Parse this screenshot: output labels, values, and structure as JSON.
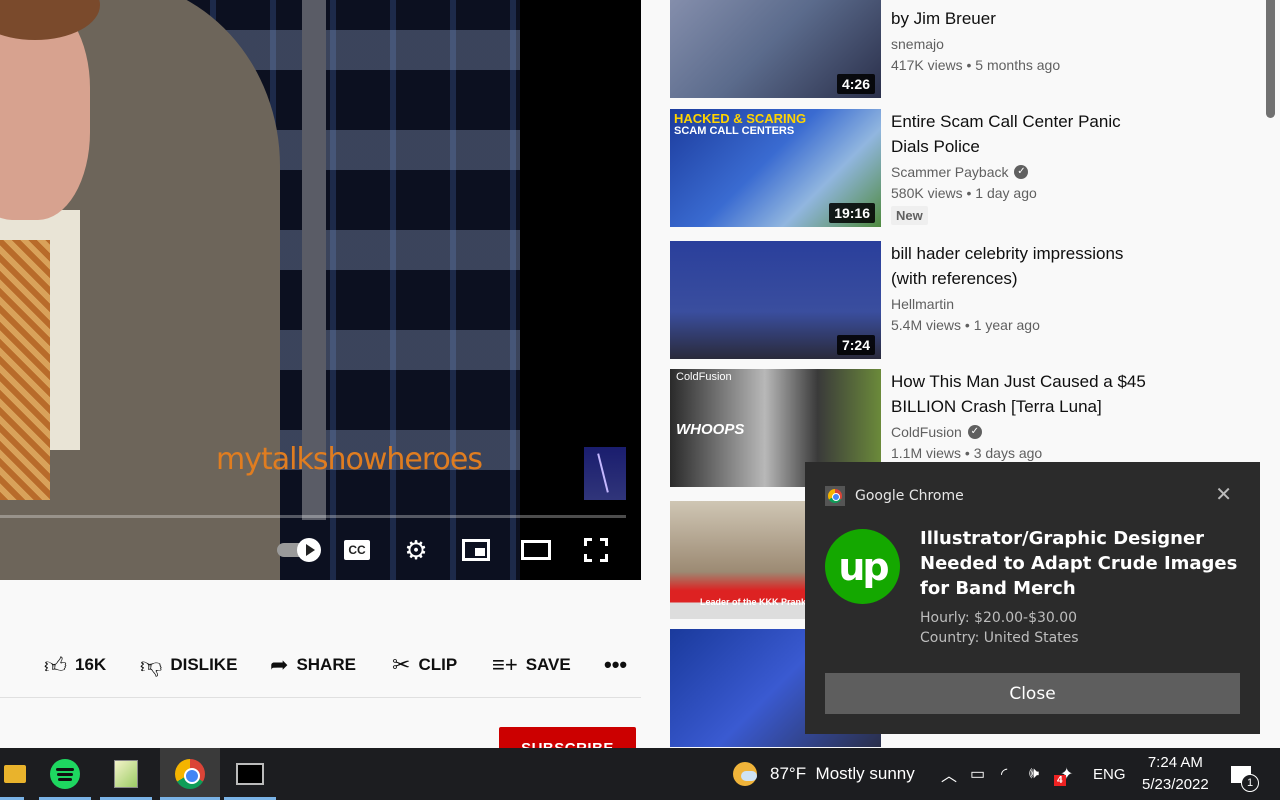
{
  "player": {
    "watermark": "mytalkshowheroes",
    "progress_fraction": 0.0,
    "controls": {
      "autoplay": "autoplay-toggle",
      "cc_label": "CC",
      "settings": "gear-icon",
      "miniplayer": "miniplayer-icon",
      "theater": "theater-icon",
      "fullscreen": "fullscreen-icon"
    }
  },
  "actions": {
    "like_count": "16K",
    "dislike_label": "DISLIKE",
    "share_label": "SHARE",
    "clip_label": "CLIP",
    "save_label": "SAVE",
    "more_label": "•••"
  },
  "subscribe_label": "SUBSCRIBE",
  "recommendations": [
    {
      "title": "by Jim Breuer",
      "channel": "snemajo",
      "verified": false,
      "views": "417K views",
      "age": "5 months ago",
      "duration": "4:26",
      "badge": ""
    },
    {
      "title": "Entire Scam Call Center Panic Dials Police",
      "channel": "Scammer Payback",
      "verified": true,
      "views": "580K views",
      "age": "1 day ago",
      "duration": "19:16",
      "badge": "New",
      "thumb_text_1": "HACKED & SCARING",
      "thumb_text_2": "SCAM CALL CENTERS"
    },
    {
      "title": "bill hader celebrity impressions (with references)",
      "channel": "Hellmartin",
      "verified": false,
      "views": "5.4M views",
      "age": "1 year ago",
      "duration": "7:24",
      "badge": ""
    },
    {
      "title": "How This Man Just Caused a $45 BILLION Crash [Terra Luna]",
      "channel": "ColdFusion",
      "verified": true,
      "views": "1.1M views",
      "age": "3 days ago",
      "duration": "",
      "badge": "",
      "thumb_text_1": "ColdFusion",
      "thumb_text_2": "WHOOPS"
    },
    {
      "title": "",
      "thumb_text_1": "Leader of the KKK Pranked"
    },
    {
      "title": ""
    }
  ],
  "separator": "•",
  "notification": {
    "app_name": "Google Chrome",
    "close_x": "✕",
    "logo_text": "up",
    "title": "Illustrator/Graphic Designer Needed to Adapt Crude Images for Band Merch",
    "line1": "Hourly: $20.00-$30.00",
    "line2": "Country: United States",
    "button_label": "Close"
  },
  "taskbar": {
    "apps": [
      "File Explorer",
      "Spotify",
      "Notepad++",
      "Google Chrome",
      "Command Prompt"
    ],
    "weather_temp": "87°F",
    "weather_desc": "Mostly sunny",
    "language": "ENG",
    "time": "7:24 AM",
    "date": "5/23/2022",
    "dropbox_badge": "4",
    "notification_count": "1"
  }
}
